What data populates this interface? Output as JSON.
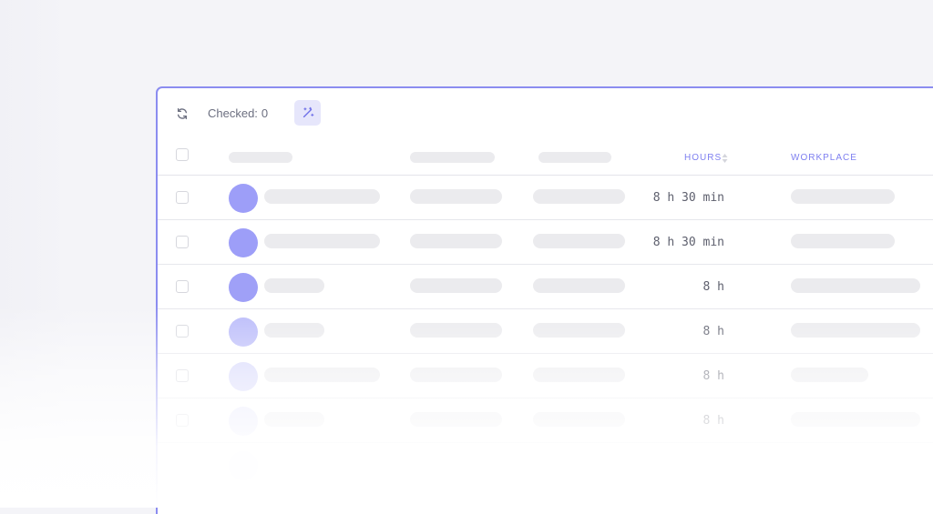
{
  "toolbar": {
    "checked_label": "Checked:",
    "checked_count": "0",
    "refresh_icon": "refresh-icon",
    "magic_icon": "magic-wand-icon"
  },
  "table": {
    "columns": [
      {
        "key": "name",
        "label": ""
      },
      {
        "key": "col2",
        "label": ""
      },
      {
        "key": "col3",
        "label": ""
      },
      {
        "key": "hours",
        "label": "HOURS",
        "sortable": true
      },
      {
        "key": "workplace",
        "label": "WORKPLACE"
      }
    ],
    "rows": [
      {
        "hours": "8 h 30 min"
      },
      {
        "hours": "8 h 30 min"
      },
      {
        "hours": "8 h"
      },
      {
        "hours": "8 h"
      },
      {
        "hours": "8 h"
      },
      {
        "hours": "8 h"
      }
    ]
  },
  "colors": {
    "accent": "#8b8cf0",
    "avatar": "#9fa0f7",
    "placeholder": "#ebebee"
  }
}
